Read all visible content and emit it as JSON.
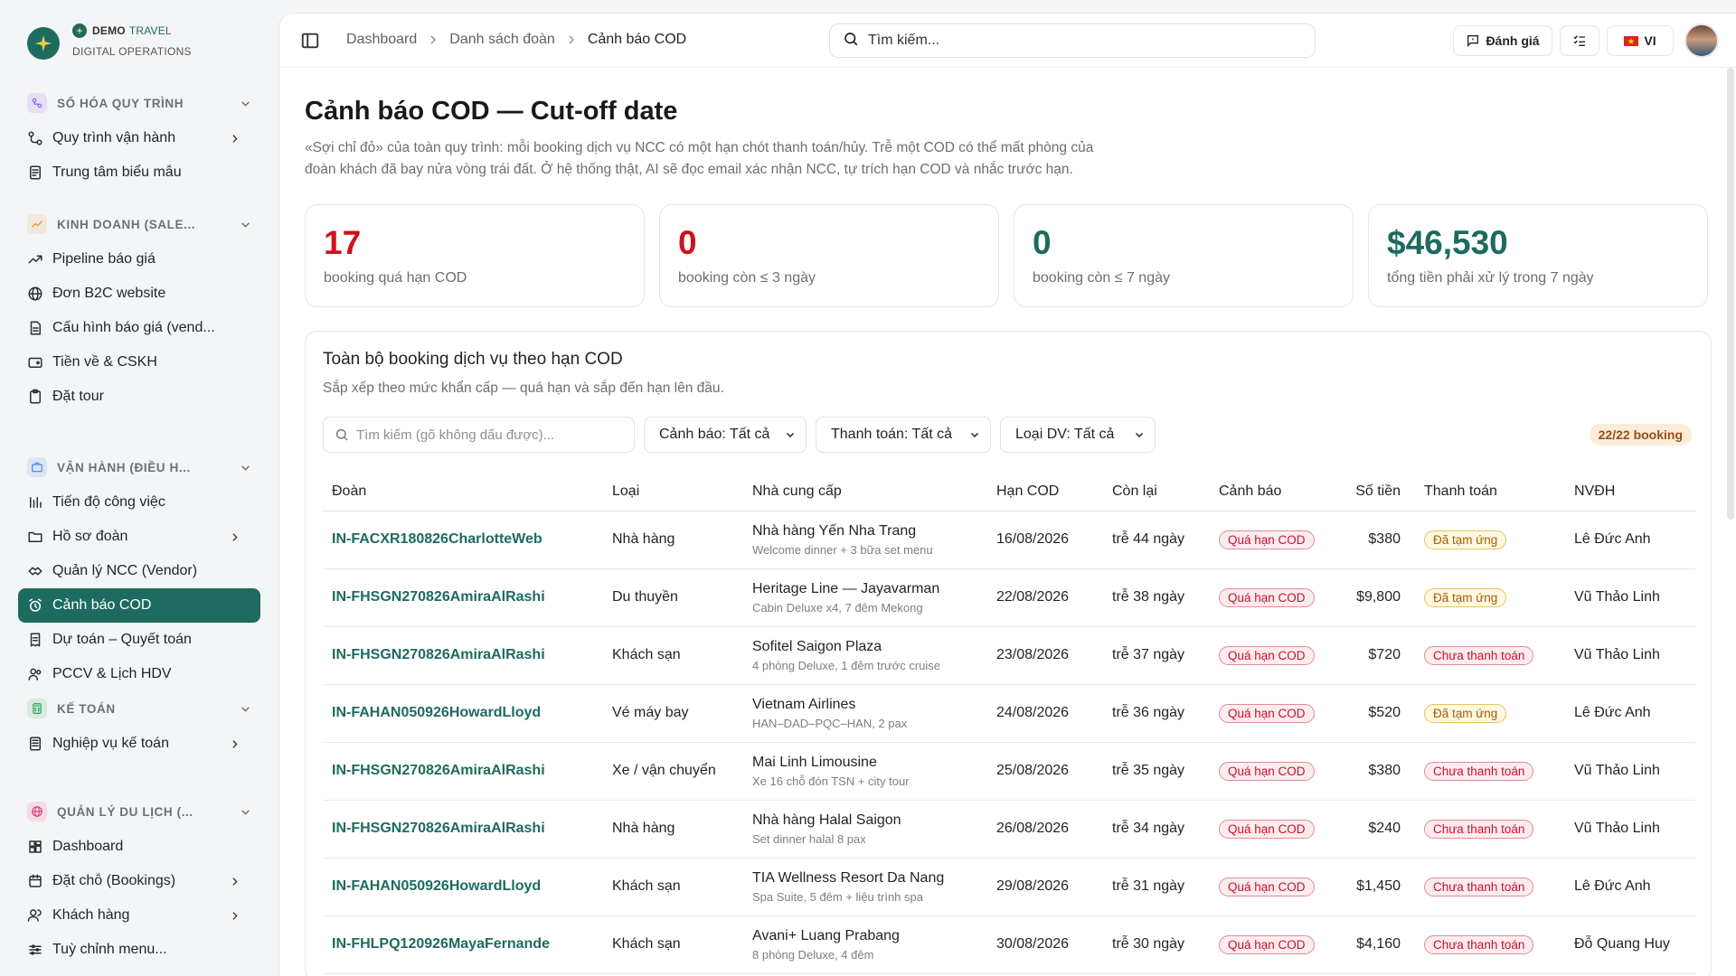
{
  "brand": {
    "name": "DEMO",
    "name_accent": "TRAVEL",
    "subtitle": "DIGITAL OPERATIONS"
  },
  "sidebar": {
    "sections": [
      {
        "label": "SỐ HÓA QUY TRÌNH",
        "icon": "flow-icon",
        "color": "#8a5cf6",
        "items": [
          {
            "label": "Quy trình vận hành",
            "icon": "workflow-icon",
            "has_children": true
          },
          {
            "label": "Trung tâm biểu mẫu",
            "icon": "form-icon",
            "has_children": false
          }
        ]
      },
      {
        "label": "KINH DOANH (SALE...",
        "icon": "trend-icon",
        "color": "#e8902a",
        "items": [
          {
            "label": "Pipeline báo giá",
            "icon": "trend-up-icon",
            "has_children": false
          },
          {
            "label": "Đơn B2C website",
            "icon": "globe-icon",
            "has_children": false
          },
          {
            "label": "Cấu hình báo giá (vend...",
            "icon": "document-icon",
            "has_children": false
          },
          {
            "label": "Tiền về & CSKH",
            "icon": "wallet-icon",
            "has_children": false
          },
          {
            "label": "Đặt tour",
            "icon": "clipboard-icon",
            "has_children": false
          }
        ]
      },
      {
        "label": "VẬN HÀNH (ĐIỀU H...",
        "icon": "briefcase-icon",
        "color": "#3b82f6",
        "items": [
          {
            "label": "Tiến độ công việc",
            "icon": "progress-icon",
            "has_children": false
          },
          {
            "label": "Hồ sơ đoàn",
            "icon": "folder-icon",
            "has_children": true
          },
          {
            "label": "Quản lý NCC (Vendor)",
            "icon": "handshake-icon",
            "has_children": false
          },
          {
            "label": "Cảnh báo COD",
            "icon": "alarm-icon",
            "has_children": false,
            "active": true
          },
          {
            "label": "Dự toán – Quyết toán",
            "icon": "receipt-icon",
            "has_children": false
          },
          {
            "label": "PCCV & Lịch HDV",
            "icon": "users-icon",
            "has_children": false
          }
        ]
      },
      {
        "label": "KẾ TOÁN",
        "icon": "calculator-icon",
        "color": "#22a35a",
        "items": [
          {
            "label": "Nghiệp vụ kế toán",
            "icon": "ledger-icon",
            "has_children": true
          }
        ]
      },
      {
        "label": "QUẢN LÝ DU LỊCH (...",
        "icon": "globe-icon",
        "color": "#e0407a",
        "items": [
          {
            "label": "Dashboard",
            "icon": "grid-icon",
            "has_children": false
          },
          {
            "label": "Đặt chỗ (Bookings)",
            "icon": "calendar-icon",
            "has_children": true
          },
          {
            "label": "Khách hàng",
            "icon": "user-icon",
            "has_children": true
          },
          {
            "label": "Tuỳ chỉnh menu...",
            "icon": "sliders-icon",
            "has_children": false
          }
        ]
      }
    ]
  },
  "topbar": {
    "breadcrumbs": [
      "Dashboard",
      "Danh sách đoàn",
      "Cảnh báo COD"
    ],
    "search_placeholder": "Tìm kiếm...",
    "feedback_label": "Đánh giá",
    "language_label": "VI"
  },
  "page": {
    "title": "Cảnh báo COD — Cut-off date",
    "description": "«Sợi chỉ đỏ» của toàn quy trình: mỗi booking dịch vụ NCC có một hạn chót thanh toán/hủy. Trễ một COD có thể mất phòng của đoàn khách đã bay nửa vòng trái đất. Ở hệ thống thật, AI sẽ đọc email xác nhận NCC, tự trích hạn COD và nhắc trước hạn."
  },
  "stats": [
    {
      "value": "17",
      "label": "booking quá hạn COD",
      "color": "#d0121e"
    },
    {
      "value": "0",
      "label": "booking còn ≤ 3 ngày",
      "color": "#d0121e"
    },
    {
      "value": "0",
      "label": "booking còn ≤ 7 ngày",
      "color": "#1d6b5e"
    },
    {
      "value": "$46,530",
      "label": "tổng tiền phải xử lý trong 7 ngày",
      "color": "#1d6b5e"
    }
  ],
  "panel": {
    "title": "Toàn bộ booking dịch vụ theo hạn COD",
    "subtitle": "Sắp xếp theo mức khẩn cấp — quá hạn và sắp đến hạn lên đầu.",
    "search_placeholder": "Tìm kiếm (gõ không dấu được)...",
    "filters": [
      "Cảnh báo: Tất cả",
      "Thanh toán: Tất cả",
      "Loại DV: Tất cả"
    ],
    "count": "22/22 booking",
    "columns": [
      "Đoàn",
      "Loại",
      "Nhà cung cấp",
      "Hạn COD",
      "Còn lại",
      "Cảnh báo",
      "Số tiền",
      "Thanh toán",
      "NVĐH"
    ],
    "rows": [
      {
        "group": "IN-FACXR180826CharlotteWeb",
        "type": "Nhà hàng",
        "vendor": "Nhà hàng Yến Nha Trang",
        "note": "Welcome dinner + 3 bữa set menu",
        "cod": "16/08/2026",
        "remaining": "trễ 44 ngày",
        "alert": "Quá hạn COD",
        "amount": "$380",
        "payment": "Đã tạm ứng",
        "payment_status": "partial",
        "staff": "Lê Đức Anh"
      },
      {
        "group": "IN-FHSGN270826AmiraAlRashi",
        "type": "Du thuyền",
        "vendor": "Heritage Line — Jayavarman",
        "note": "Cabin Deluxe x4, 7 đêm Mekong",
        "cod": "22/08/2026",
        "remaining": "trễ 38 ngày",
        "alert": "Quá hạn COD",
        "amount": "$9,800",
        "payment": "Đã tạm ứng",
        "payment_status": "partial",
        "staff": "Vũ Thảo Linh"
      },
      {
        "group": "IN-FHSGN270826AmiraAlRashi",
        "type": "Khách sạn",
        "vendor": "Sofitel Saigon Plaza",
        "note": "4 phòng Deluxe, 1 đêm trước cruise",
        "cod": "23/08/2026",
        "remaining": "trễ 37 ngày",
        "alert": "Quá hạn COD",
        "amount": "$720",
        "payment": "Chưa thanh toán",
        "payment_status": "unpaid",
        "staff": "Vũ Thảo Linh"
      },
      {
        "group": "IN-FAHAN050926HowardLloyd",
        "type": "Vé máy bay",
        "vendor": "Vietnam Airlines",
        "note": "HAN–DAD–PQC–HAN, 2 pax",
        "cod": "24/08/2026",
        "remaining": "trễ 36 ngày",
        "alert": "Quá hạn COD",
        "amount": "$520",
        "payment": "Đã tạm ứng",
        "payment_status": "partial",
        "staff": "Lê Đức Anh"
      },
      {
        "group": "IN-FHSGN270826AmiraAlRashi",
        "type": "Xe / vận chuyển",
        "vendor": "Mai Linh Limousine",
        "note": "Xe 16 chỗ đón TSN + city tour",
        "cod": "25/08/2026",
        "remaining": "trễ 35 ngày",
        "alert": "Quá hạn COD",
        "amount": "$380",
        "payment": "Chưa thanh toán",
        "payment_status": "unpaid",
        "staff": "Vũ Thảo Linh"
      },
      {
        "group": "IN-FHSGN270826AmiraAlRashi",
        "type": "Nhà hàng",
        "vendor": "Nhà hàng Halal Saigon",
        "note": "Set dinner halal 8 pax",
        "cod": "26/08/2026",
        "remaining": "trễ 34 ngày",
        "alert": "Quá hạn COD",
        "amount": "$240",
        "payment": "Chưa thanh toán",
        "payment_status": "unpaid",
        "staff": "Vũ Thảo Linh"
      },
      {
        "group": "IN-FAHAN050926HowardLloyd",
        "type": "Khách sạn",
        "vendor": "TIA Wellness Resort Da Nang",
        "note": "Spa Suite, 5 đêm + liệu trình spa",
        "cod": "29/08/2026",
        "remaining": "trễ 31 ngày",
        "alert": "Quá hạn COD",
        "amount": "$1,450",
        "payment": "Chưa thanh toán",
        "payment_status": "unpaid",
        "staff": "Lê Đức Anh"
      },
      {
        "group": "IN-FHLPQ120926MayaFernande",
        "type": "Khách sạn",
        "vendor": "Avani+ Luang Prabang",
        "note": "8 phòng Deluxe, 4 đêm",
        "cod": "30/08/2026",
        "remaining": "trễ 30 ngày",
        "alert": "Quá hạn COD",
        "amount": "$4,160",
        "payment": "Chưa thanh toán",
        "payment_status": "unpaid",
        "staff": "Đỗ Quang Huy"
      }
    ]
  }
}
